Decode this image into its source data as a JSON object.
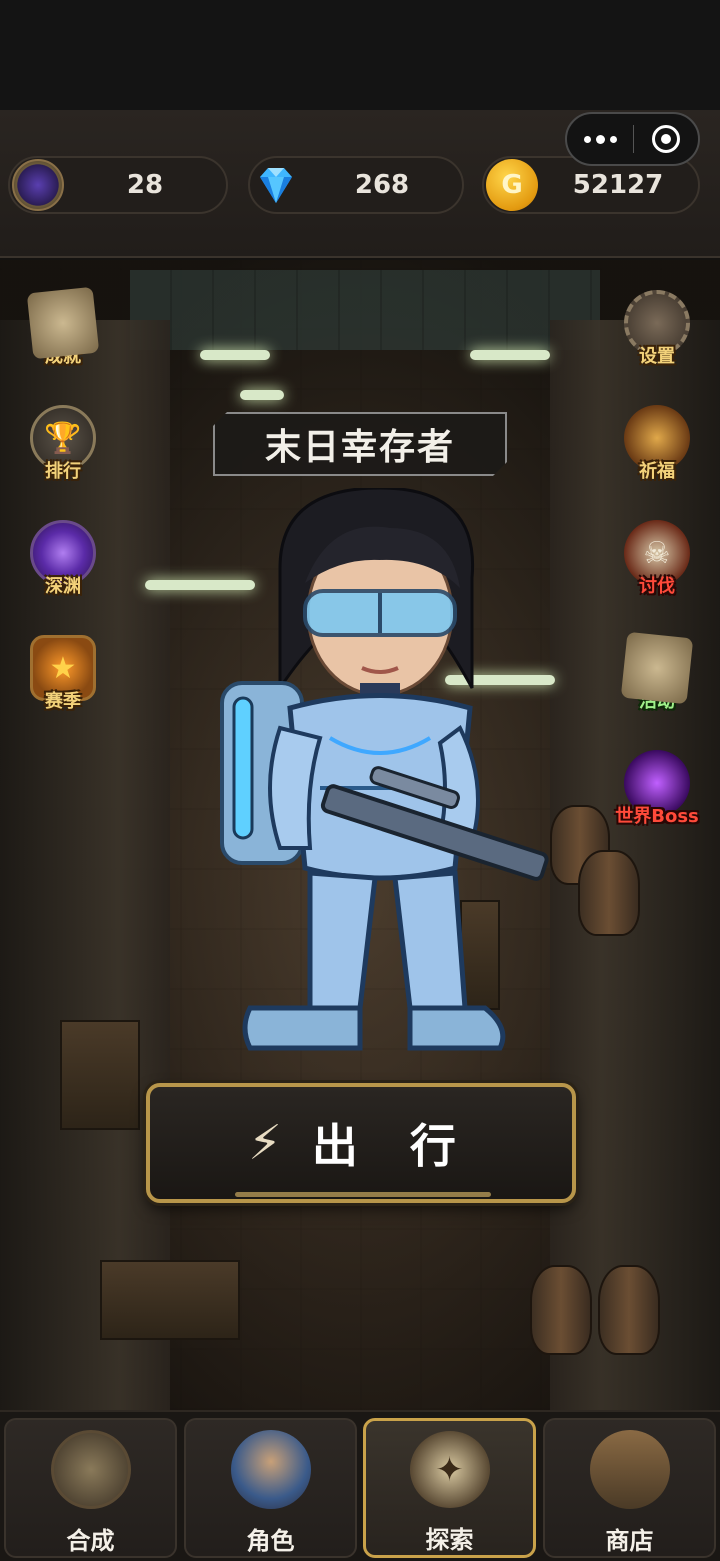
{
  "resources": {
    "soul": {
      "icon": "soul-orb-icon",
      "value": "28"
    },
    "gem": {
      "icon": "diamond-icon",
      "value": "268"
    },
    "gold": {
      "icon": "gold-coin-icon",
      "symbol": "G",
      "value": "52127"
    }
  },
  "capsule": {
    "more_icon": "more-dots-icon",
    "close_icon": "target-close-icon"
  },
  "left_menu": [
    {
      "label": "成就",
      "icon": "scroll-icon"
    },
    {
      "label": "排行",
      "icon": "trophy-icon"
    },
    {
      "label": "深渊",
      "icon": "abyss-vortex-icon"
    },
    {
      "label": "赛季",
      "icon": "star-badge-icon"
    }
  ],
  "right_menu": [
    {
      "label": "设置",
      "icon": "gear-icon"
    },
    {
      "label": "祈福",
      "icon": "prayer-icon"
    },
    {
      "label": "讨伐",
      "icon": "skull-icon"
    },
    {
      "label": "活动",
      "icon": "scroll-icon"
    },
    {
      "label": "世界Boss",
      "icon": "boss-icon"
    }
  ],
  "character": {
    "title": "末日幸存者"
  },
  "go_button": {
    "label": "出 行",
    "icon": "lightning-icon",
    "bolt": "⚡"
  },
  "bottom_nav": [
    {
      "label": "合成",
      "icon": "crafting-icon",
      "active": false
    },
    {
      "label": "角色",
      "icon": "character-icon",
      "active": false
    },
    {
      "label": "探索",
      "icon": "compass-icon",
      "active": true
    },
    {
      "label": "商店",
      "icon": "shop-icon",
      "active": false
    }
  ],
  "colors": {
    "accent_gold": "#c9a24a",
    "label_gold": "#f3d27a",
    "label_red": "#ff4a3a",
    "label_green": "#9ff08a"
  }
}
